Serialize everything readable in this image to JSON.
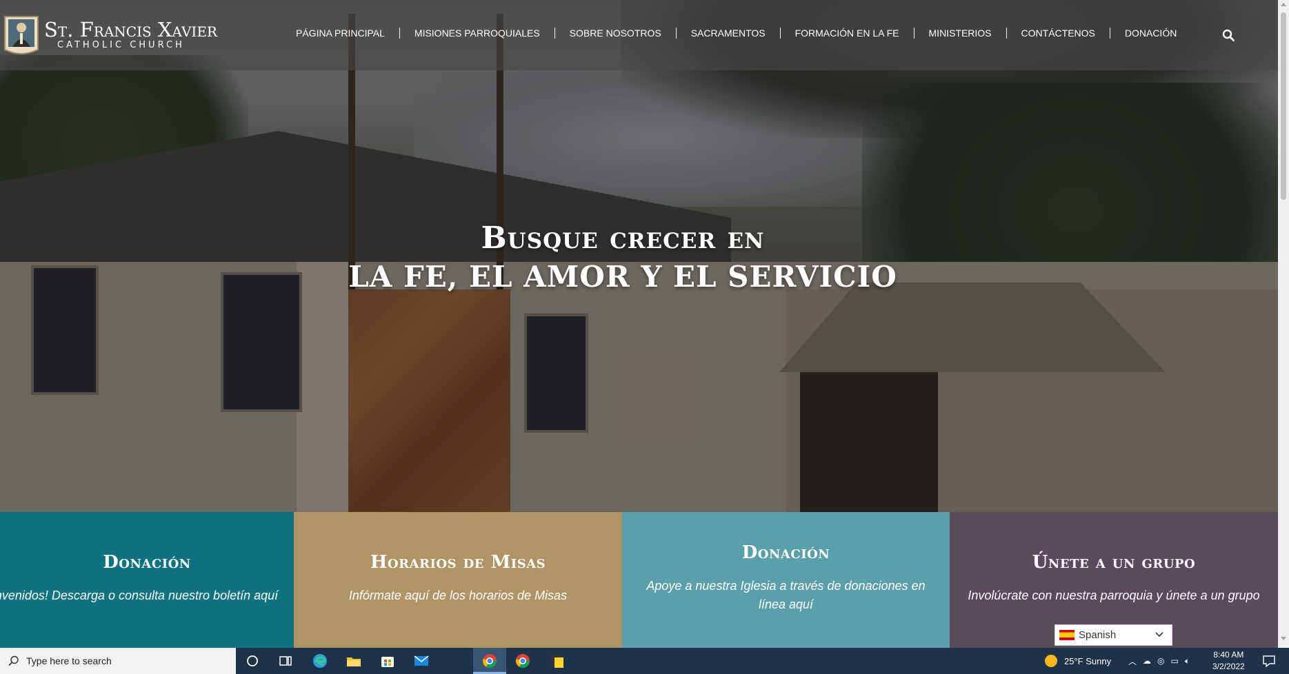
{
  "header": {
    "logo_name": "St. Francis Xavier",
    "logo_sub": "CATHOLIC CHURCH",
    "nav": [
      "PÁGINA PRINCIPAL",
      "MISIONES PARROQUIALES",
      "SOBRE NOSOTROS",
      "SACRAMENTOS",
      "FORMACIÓN EN LA FE",
      "MINISTERIOS",
      "CONTÁCTENOS",
      "DONACIÓN"
    ]
  },
  "hero": {
    "line1": "Busque crecer en",
    "line2": "LA FE, EL AMOR Y EL SERVICIO"
  },
  "cards": [
    {
      "title": "Donación",
      "text": "envenidos! Descarga o consulta nuestro boletín aquí",
      "color": "#0e7280"
    },
    {
      "title": "Horarios de Misas",
      "text": "Infórmate aquí de los horarios de Misas",
      "color": "#b09466"
    },
    {
      "title": "Donación",
      "text": "Apoye a nuestra Iglesia a través de donaciones en línea aquí",
      "color": "#5b9fab"
    },
    {
      "title": "Únete a un grupo",
      "text": "Involúcrate con nuestra parroquia y únete a un grupo",
      "color": "#5b4a5e"
    }
  ],
  "language": {
    "selected": "Spanish"
  },
  "taskbar": {
    "search_placeholder": "Type here to search",
    "weather": "25°F  Sunny",
    "time": "8:40 AM",
    "date": "3/2/2022"
  }
}
